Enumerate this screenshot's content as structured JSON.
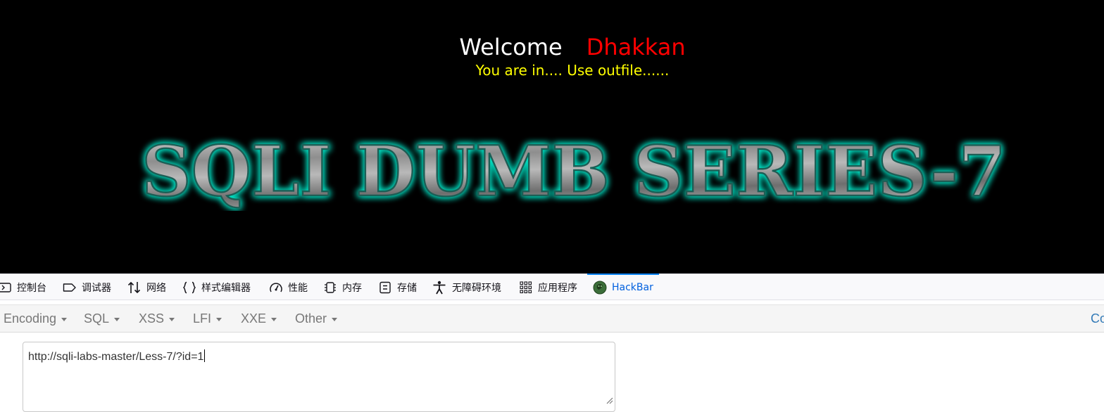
{
  "page": {
    "welcome_label": "Welcome",
    "user_name": "Dhakkan",
    "status_message": "You are in.... Use outfile......",
    "banner_text": "SQLI DUMB SERIES-7"
  },
  "devtools": {
    "tabs": [
      {
        "label": "控制台",
        "icon": "console-icon"
      },
      {
        "label": "调试器",
        "icon": "debugger-icon"
      },
      {
        "label": "网络",
        "icon": "network-arrows-icon"
      },
      {
        "label": "样式编辑器",
        "icon": "curly-braces-icon"
      },
      {
        "label": "性能",
        "icon": "gauge-icon"
      },
      {
        "label": "内存",
        "icon": "memory-chip-icon"
      },
      {
        "label": "存储",
        "icon": "storage-icon"
      },
      {
        "label": "无障碍环境",
        "icon": "accessibility-icon"
      },
      {
        "label": "应用程序",
        "icon": "app-grid-icon"
      },
      {
        "label": "HackBar",
        "icon": "hackbar-logo-icon",
        "active": true
      }
    ]
  },
  "hackbar": {
    "menus": [
      "Encoding",
      "SQL",
      "XSS",
      "LFI",
      "XXE",
      "Other"
    ],
    "contribute_label": "Co",
    "url_value": "http://sqli-labs-master/Less-7/?id=1"
  },
  "colors": {
    "page_background": "#000000",
    "welcome_text": "#ffffff",
    "user_name": "#ff0000",
    "status_text": "#ffff00",
    "banner_glow": "#00e6c8",
    "active_tab": "#0060df",
    "link": "#337ab7"
  }
}
